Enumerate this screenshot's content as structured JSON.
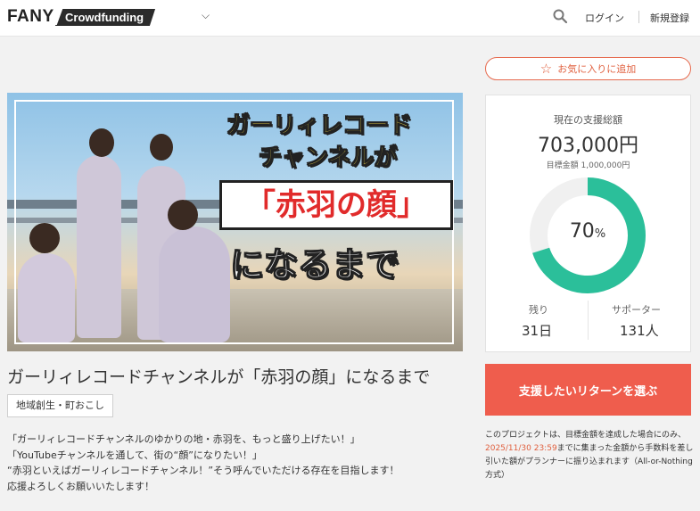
{
  "header": {
    "logo_brand": "FANY",
    "logo_product": "Crowdfunding",
    "login": "ログイン",
    "signup": "新規登録",
    "icons": [
      "chevron-down-icon",
      "search-icon"
    ]
  },
  "hero": {
    "line1a": "ガーリィレコード",
    "line1b": "チャンネルが",
    "badge": "「赤羽の顔」",
    "line3": "になるまで"
  },
  "project": {
    "title": "ガーリィレコードチャンネルが「赤羽の顔」になるまで",
    "tag": "地域創生・町おこし",
    "description": [
      "「ガーリィレコードチャンネルのゆかりの地・赤羽を、もっと盛り上げたい！」",
      "「YouTubeチャンネルを通して、街の“顔”になりたい！」",
      "“赤羽といえばガーリィレコードチャンネル！”そう呼んでいただける存在を目指します！",
      "応援よろしくお願いいたします！"
    ]
  },
  "favorite": {
    "label": "お気に入りに追加",
    "icon": "star-outline-icon"
  },
  "funding": {
    "label": "現在の支援総額",
    "amount": "703,000円",
    "goal": "目標金額 1,000,000円",
    "percent_value": 0.7,
    "percent": "70",
    "percent_unit": "%",
    "remaining_label": "残り",
    "remaining_value": "31日",
    "supporters_label": "サポーター",
    "supporters_value": "131人",
    "colors": {
      "progress": "#2bbf9a",
      "track": "#f0f0f0"
    }
  },
  "cta": {
    "label": "支援したいリターンを選ぶ",
    "color": "#ef5d4d"
  },
  "note": {
    "part1": "このプロジェクトは、目標金額を達成した場合にのみ、",
    "deadline": "2025/11/30 23:59",
    "part2": "までに集まった金額から手数料を差し引いた額がプランナーに振り込まれます（All-or-Nothing方式）"
  }
}
